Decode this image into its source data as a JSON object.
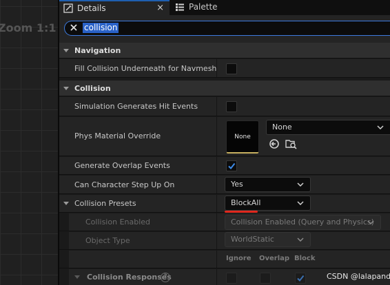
{
  "viewport": {
    "zoom_label": "Zoom 1:1"
  },
  "tabs": [
    {
      "label": "Details",
      "icon": "pencil-icon",
      "active": true,
      "close": "×"
    },
    {
      "label": "Palette",
      "icon": "palette-icon",
      "active": false
    }
  ],
  "search": {
    "value": "collision"
  },
  "categories": {
    "navigation": "Navigation",
    "collision": "Collision"
  },
  "navigation": {
    "fill_collision_label": "Fill Collision Underneath for Navmesh",
    "fill_collision_checked": false
  },
  "collision": {
    "sim_hit_label": "Simulation Generates Hit Events",
    "sim_hit_checked": false,
    "phys_material_label": "Phys Material Override",
    "phys_material_thumb": "None",
    "phys_material_value": "None",
    "overlap_label": "Generate Overlap Events",
    "overlap_checked": true,
    "step_up_label": "Can Character Step Up On",
    "step_up_value": "Yes",
    "presets_label": "Collision Presets",
    "presets_value": "BlockAll",
    "enabled_label": "Collision Enabled",
    "enabled_value": "Collision Enabled (Query and Physics)",
    "object_type_label": "Object Type",
    "object_type_value": "WorldStatic",
    "response_headers": [
      "Ignore",
      "Overlap",
      "Block"
    ],
    "responses_label": "Collision Responses",
    "responses_help": "?",
    "responses_state": {
      "ignore": false,
      "overlap": false,
      "block": true
    }
  },
  "colors": {
    "accent": "#3d7be0",
    "selection": "#2a62c8",
    "highlight": "#e0281e"
  },
  "watermark": "CSDN @lalapanda"
}
